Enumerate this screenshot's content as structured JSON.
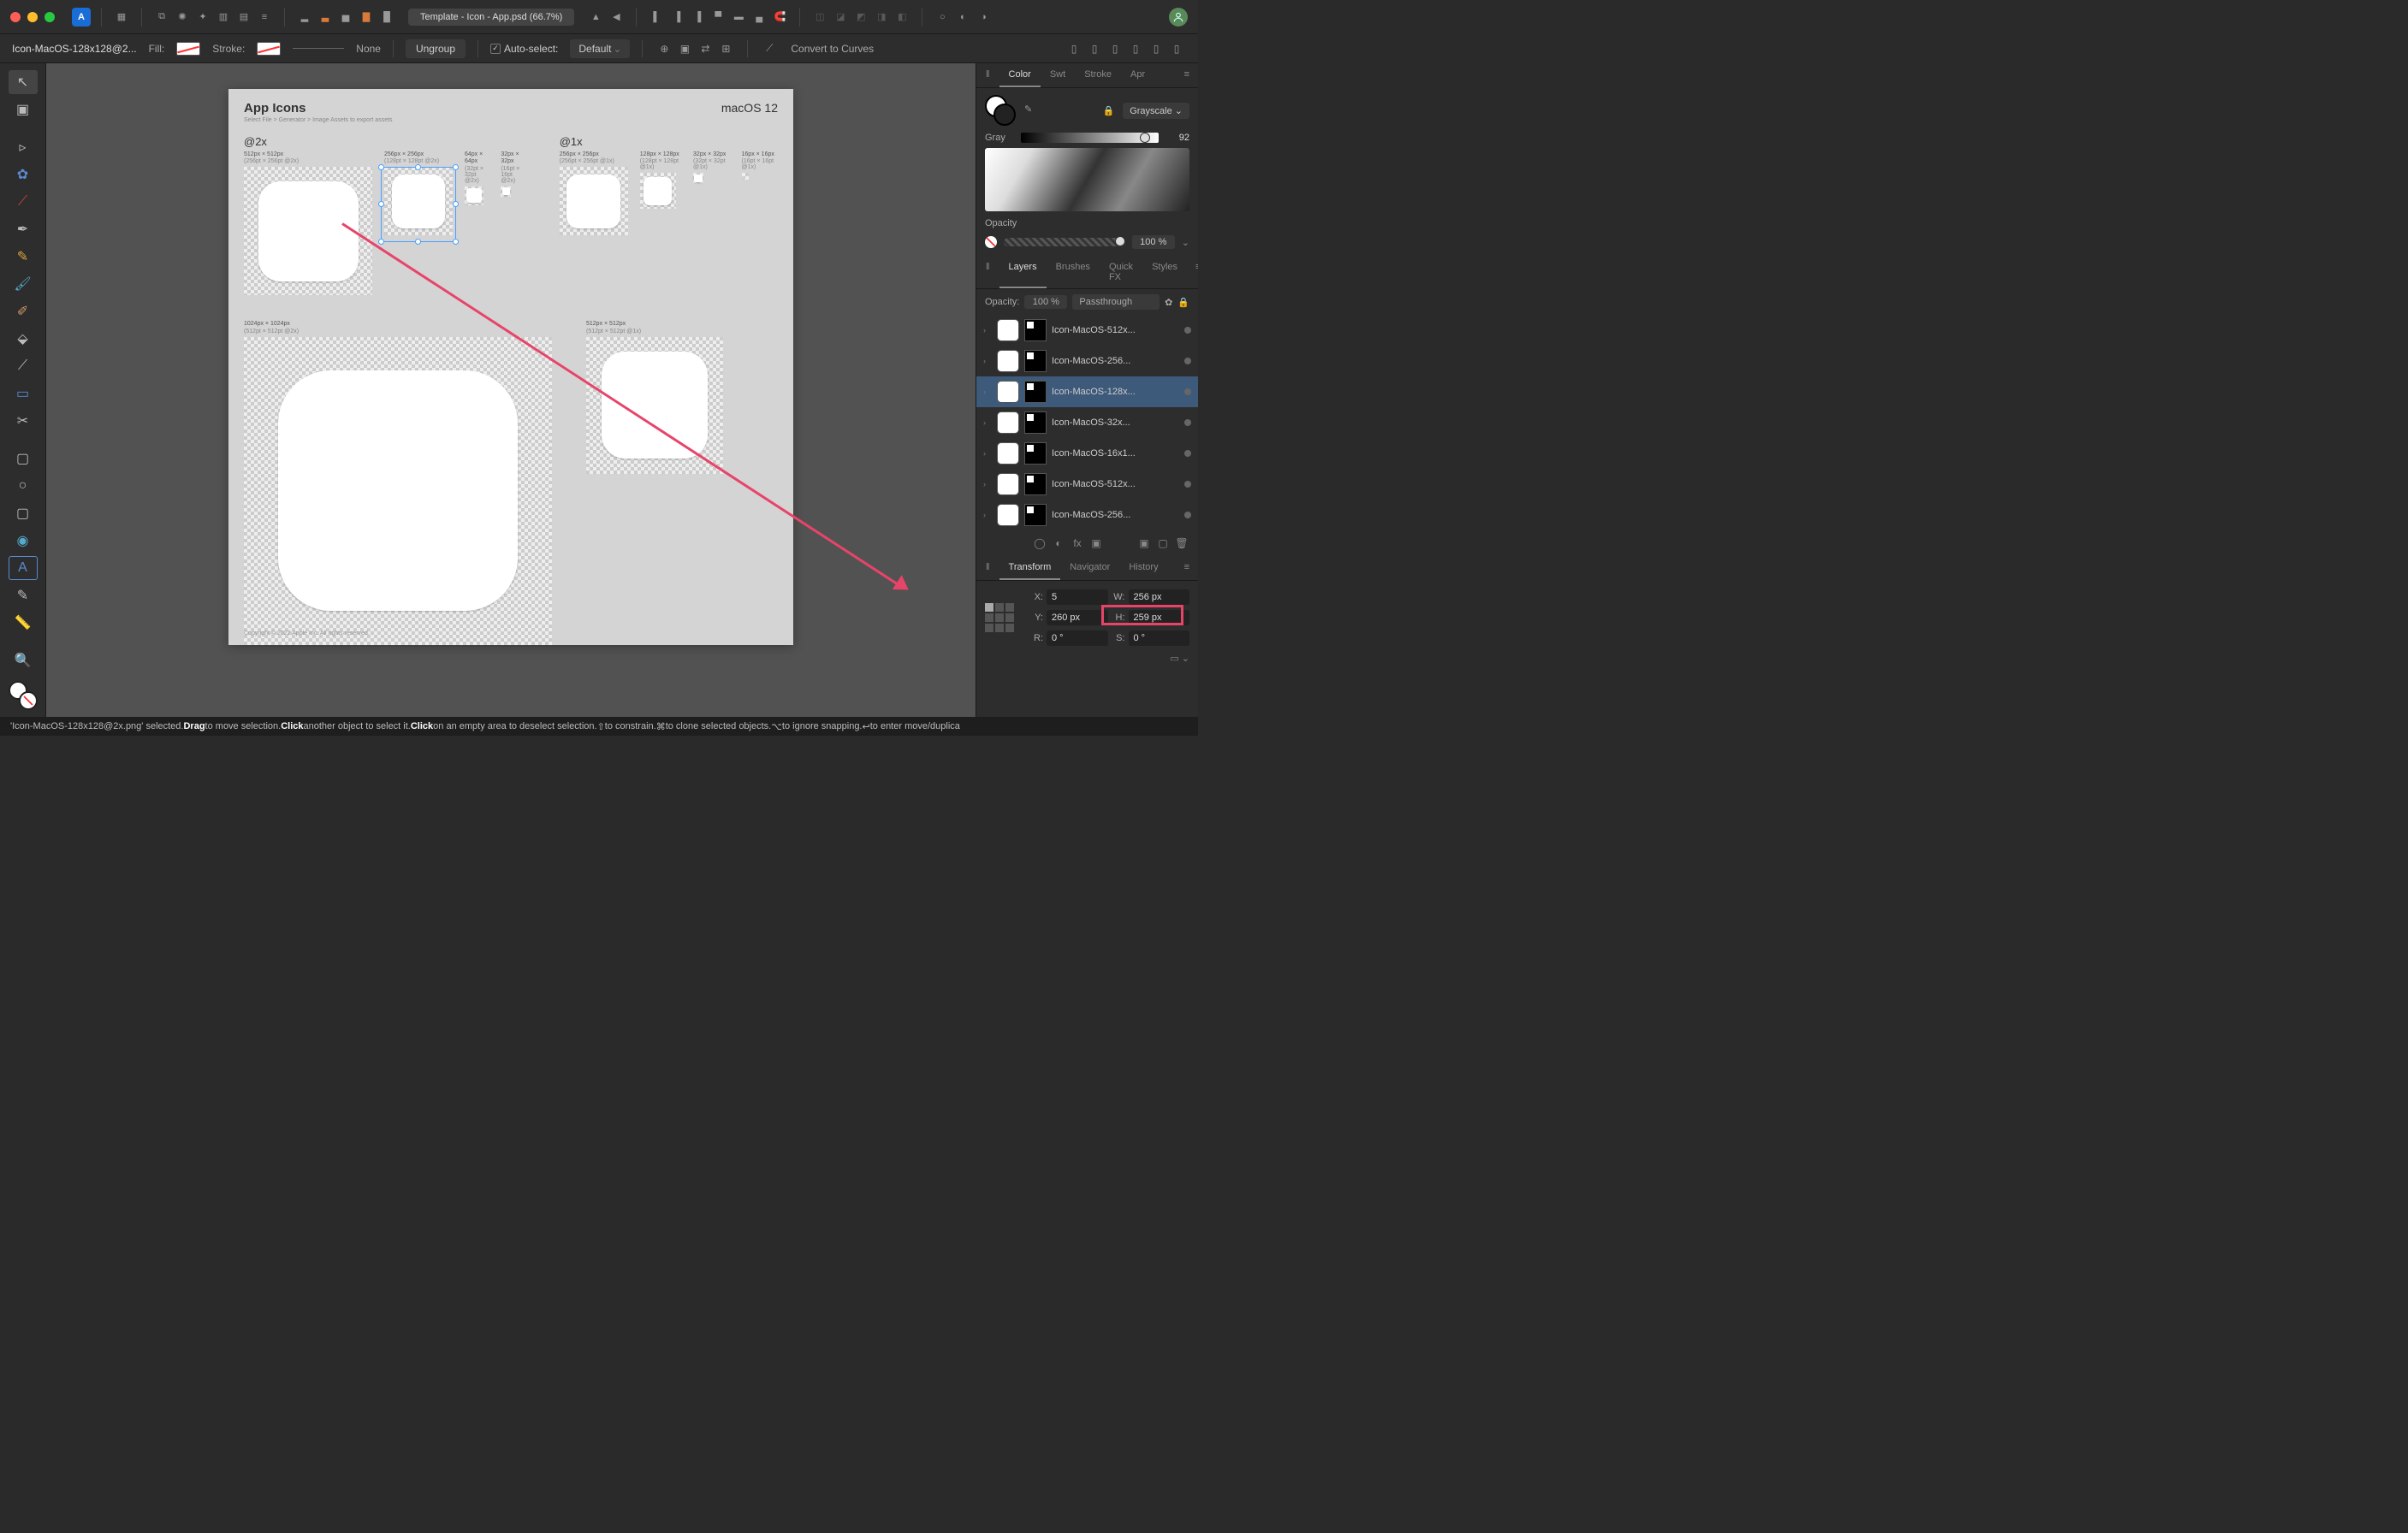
{
  "titlebar": {
    "doc_title": "Template - Icon - App.psd (66.7%)"
  },
  "context": {
    "selection_name": "Icon-MacOS-128x128@2...",
    "fill_label": "Fill:",
    "stroke_label": "Stroke:",
    "stroke_width": "None",
    "ungroup": "Ungroup",
    "autoselect": "Auto-select:",
    "autoselect_mode": "Default",
    "convert": "Convert to Curves"
  },
  "canvas": {
    "title": "App Icons",
    "subtitle": "Select File > Generator > Image Assets to export assets",
    "os_label": "macOS 12",
    "at2x": "@2x",
    "at1x": "@1x",
    "a512": "512px × 512px",
    "a512b": "(256pt × 256pt @2x)",
    "a256": "256px × 256px",
    "a256b": "(128pt × 128pt @2x)",
    "a64": "64px × 64px",
    "a64b": "(32pt × 32pt @2x)",
    "a32": "32px × 32px",
    "a32b": "(16pt × 16pt @2x)",
    "b256": "256px × 256px",
    "b256b": "(256pt × 256pt @1x)",
    "b128": "128px × 128px",
    "b128b": "(128pt × 128pt @1x)",
    "b32": "32px × 32px",
    "b32b": "(32pt × 32pt @1x)",
    "b16": "16px × 16px",
    "b16b": "(16pt × 16pt @1x)",
    "a1024": "1024px × 1024px",
    "a1024b": "(512pt × 512pt @2x)",
    "b512": "512px × 512px",
    "b512b": "(512pt × 512pt @1x)",
    "copyright": "Copyright © 2022 Apple Inc. All rights reserved."
  },
  "color_panel": {
    "tabs": {
      "color": "Color",
      "swatches": "Swt",
      "stroke": "Stroke",
      "appearance": "Apr"
    },
    "mode": "Grayscale",
    "gray_label": "Gray",
    "gray_value": "92",
    "opacity_label": "Opacity",
    "opacity_value": "100 %"
  },
  "layers_panel": {
    "tabs": {
      "layers": "Layers",
      "brushes": "Brushes",
      "quickfx": "Quick FX",
      "styles": "Styles"
    },
    "opacity_label": "Opacity:",
    "opacity_value": "100 %",
    "blend": "Passthrough",
    "items": [
      {
        "name": "Icon-MacOS-512x..."
      },
      {
        "name": "Icon-MacOS-256..."
      },
      {
        "name": "Icon-MacOS-128x...",
        "selected": true
      },
      {
        "name": "Icon-MacOS-32x..."
      },
      {
        "name": "Icon-MacOS-16x1..."
      },
      {
        "name": "Icon-MacOS-512x..."
      },
      {
        "name": "Icon-MacOS-256..."
      }
    ]
  },
  "transform_panel": {
    "tabs": {
      "transform": "Transform",
      "navigator": "Navigator",
      "history": "History"
    },
    "x_label": "X:",
    "x_value": "5",
    "y_label": "Y:",
    "y_value": "260 px",
    "w_label": "W:",
    "w_value": "256 px",
    "h_label": "H:",
    "h_value": "259 px",
    "r_label": "R:",
    "r_value": "0 °",
    "s_label": "S:",
    "s_value": "0 °"
  },
  "status": {
    "text_a": "'Icon-MacOS-128x128@2x.png' selected. ",
    "drag": "Drag",
    "text_b": " to move selection. ",
    "click": "Click",
    "text_c": " another object to select it. ",
    "click2": "Click",
    "text_d": " on an empty area to deselect selection. ",
    "shift": "⇧",
    "text_e": " to constrain. ",
    "cmd": "⌘",
    "text_f": " to clone selected objects. ",
    "opt": "⌥",
    "text_g": " to ignore snapping. ",
    "ret": "↩",
    "text_h": " to enter move/duplica"
  }
}
